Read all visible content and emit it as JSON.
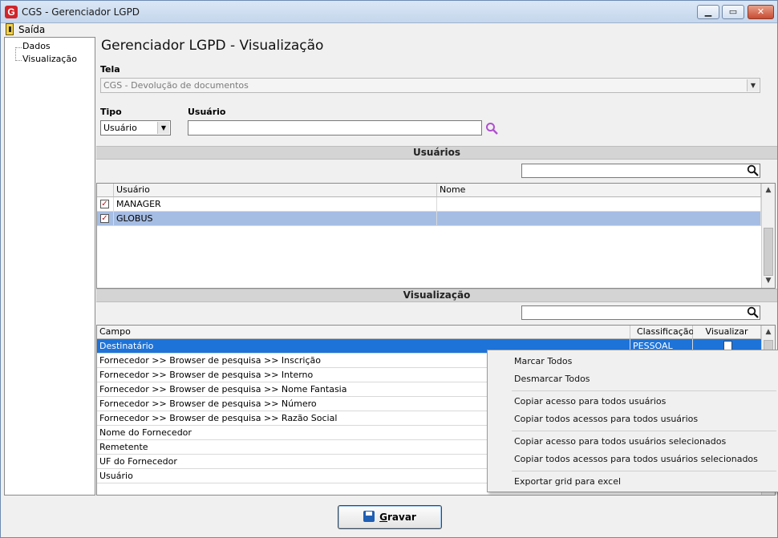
{
  "window": {
    "title": "CGS - Gerenciador LGPD",
    "min": "▁",
    "max": "▭",
    "close": "✕"
  },
  "menu": {
    "saida": "Saída"
  },
  "tree": {
    "items": [
      "Dados",
      "Visualização"
    ]
  },
  "page": {
    "title": "Gerenciador LGPD - Visualização"
  },
  "tela": {
    "label": "Tela",
    "value": "CGS - Devolução de documentos"
  },
  "tipo": {
    "label": "Tipo",
    "value": "Usuário"
  },
  "usuario": {
    "label": "Usuário",
    "value": ""
  },
  "usuarios_section": {
    "title": "Usuários",
    "columns": [
      "Usuário",
      "Nome"
    ],
    "rows": [
      {
        "usuario": "MANAGER",
        "nome": "",
        "checked": true
      },
      {
        "usuario": "GLOBUS",
        "nome": "",
        "checked": true
      }
    ]
  },
  "visualizacao_section": {
    "title": "Visualização",
    "columns": [
      "Campo",
      "Classificação",
      "Visualizar"
    ],
    "rows": [
      {
        "campo": "Destinatário",
        "classificacao": "PESSOAL"
      },
      {
        "campo": "Fornecedor >> Browser de pesquisa >> Inscrição"
      },
      {
        "campo": "Fornecedor >> Browser de pesquisa >> Interno"
      },
      {
        "campo": "Fornecedor >> Browser de pesquisa >> Nome Fantasia"
      },
      {
        "campo": "Fornecedor >> Browser de pesquisa >> Número"
      },
      {
        "campo": "Fornecedor >> Browser de pesquisa >> Razão Social"
      },
      {
        "campo": "Nome do Fornecedor"
      },
      {
        "campo": "Remetente"
      },
      {
        "campo": "UF do Fornecedor"
      },
      {
        "campo": "Usuário"
      }
    ]
  },
  "context_menu": {
    "items": [
      "Marcar Todos",
      "Desmarcar Todos",
      "Copiar acesso para todos usuários",
      "Copiar todos acessos para todos usuários",
      "Copiar acesso para todos usuários selecionados",
      "Copiar todos acessos para todos usuários selecionados",
      "Exportar grid para excel"
    ]
  },
  "buttons": {
    "gravar_first": "G",
    "gravar_rest": "ravar"
  },
  "colors": {
    "accent": "#1e73d8",
    "selected_row": "#a6bde3",
    "search_icon": "#b04fd0"
  }
}
